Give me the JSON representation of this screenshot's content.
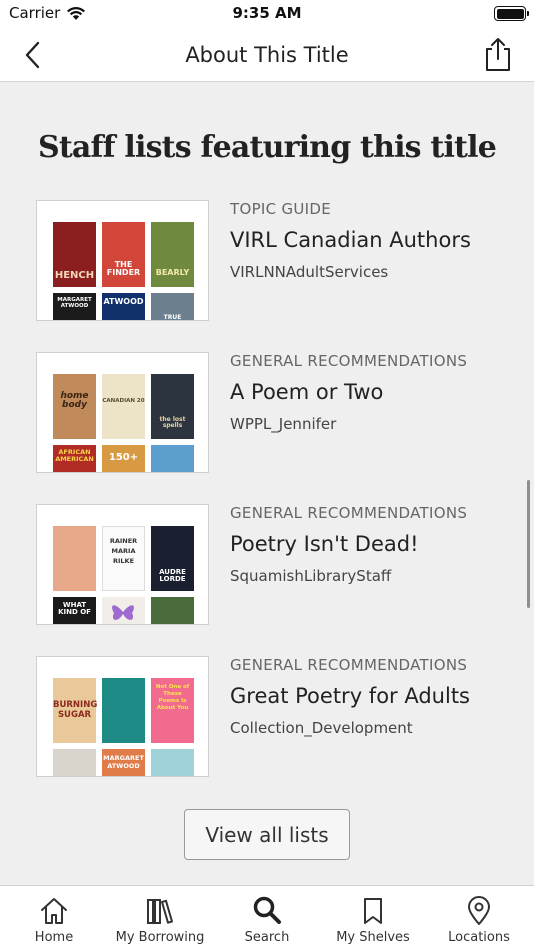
{
  "status_bar": {
    "carrier": "Carrier",
    "time": "9:35 AM"
  },
  "nav": {
    "title": "About This Title"
  },
  "section": {
    "title": "Staff lists featuring this title"
  },
  "lists": [
    {
      "type": "TOPIC GUIDE",
      "name": "VIRL Canadian Authors",
      "owner": "VIRLNNAdultServices",
      "cover_texts": [
        "HENCH",
        "THE FINDER",
        "BEARLY",
        "MARGARET ATWOOD",
        "ATWOOD",
        "TRUE"
      ]
    },
    {
      "type": "GENERAL RECOMMENDATIONS",
      "name": "A Poem or Two",
      "owner": "WPPL_Jennifer",
      "cover_texts": [
        "home body",
        "CANADIAN 20",
        "the lost spells",
        "AFRICAN AMERICAN",
        "150+",
        ""
      ]
    },
    {
      "type": "GENERAL RECOMMENDATIONS",
      "name": "Poetry Isn't Dead!",
      "owner": "SquamishLibraryStaff",
      "cover_texts": [
        "",
        "RAINER MARIA RILKE",
        "AUDRE LORDE",
        "WHAT KIND OF",
        "",
        ""
      ]
    },
    {
      "type": "GENERAL RECOMMENDATIONS",
      "name": "Great Poetry for Adults",
      "owner": "Collection_Development",
      "cover_texts": [
        "BURNING SUGAR",
        "",
        "Not One of These Poems Is About You",
        "",
        "MARGARET ATWOOD",
        ""
      ]
    }
  ],
  "view_all": {
    "label": "View all lists"
  },
  "tabs": [
    {
      "label": "Home",
      "icon": "home-icon"
    },
    {
      "label": "My Borrowing",
      "icon": "books-icon"
    },
    {
      "label": "Search",
      "icon": "search-icon"
    },
    {
      "label": "My Shelves",
      "icon": "bookmark-icon"
    },
    {
      "label": "Locations",
      "icon": "location-pin-icon"
    }
  ]
}
